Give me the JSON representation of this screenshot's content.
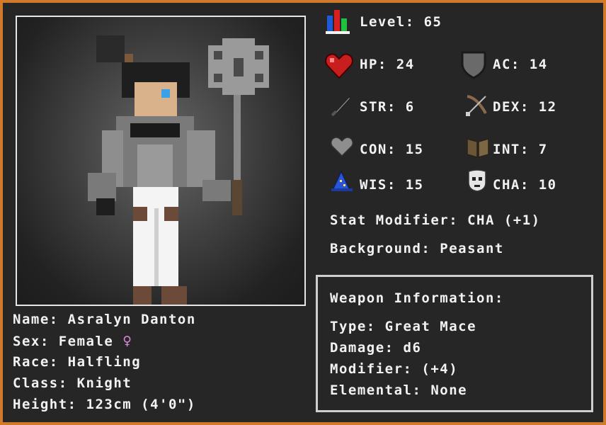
{
  "stats": {
    "level": "Level: 65",
    "hp": "HP: 24",
    "ac": "AC: 14",
    "str": "STR: 6",
    "dex": "DEX: 12",
    "con": "CON: 15",
    "int": "INT: 7",
    "wis": "WIS: 15",
    "cha": "CHA: 10",
    "stat_modifier": "Stat Modifier: CHA (+1)",
    "background": "Background: Peasant"
  },
  "character": {
    "name": "Name: Asralyn Danton",
    "sex": "Sex: Female",
    "sex_symbol": "♀",
    "race": "Race: Halfling",
    "class": "Class: Knight",
    "height": "Height: 123cm (4'0\")"
  },
  "weapon": {
    "heading": "Weapon Information:",
    "type": "Type: Great Mace",
    "damage": "Damage: d6",
    "modifier": "Modifier: (+4)",
    "elemental": "Elemental: None"
  },
  "colors": {
    "frame": "#d27a2c",
    "panel": "#262626",
    "text": "#f2f2f2",
    "sex_symbol": "#e08ae0"
  },
  "icons": [
    "level-bars-icon",
    "heart-icon",
    "shield-icon",
    "sword-icon",
    "bow-icon",
    "gray-heart-icon",
    "book-icon",
    "wizard-hat-icon",
    "mask-icon"
  ]
}
